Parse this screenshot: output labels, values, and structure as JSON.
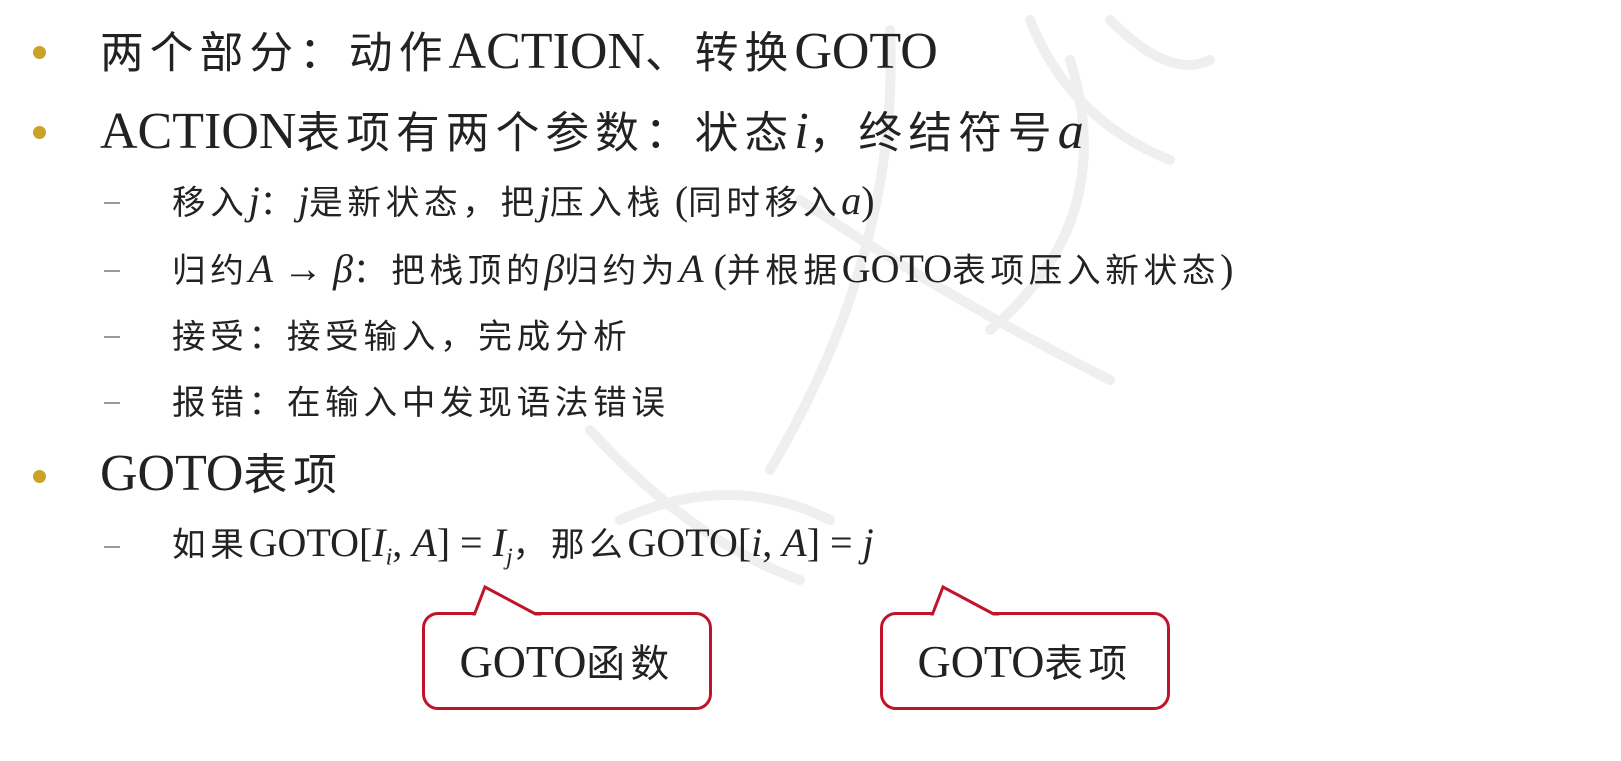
{
  "bullets": [
    {
      "text_a": "两个部分：动作",
      "text_b": "ACTION",
      "text_c": "、转换",
      "text_d": "GOTO"
    },
    {
      "text_a": "ACTION",
      "text_b": "表项有两个参数：状态",
      "var_i": "i",
      "text_c": "，终结符号",
      "var_a": "a",
      "subitems": [
        {
          "label": "移入",
          "var_j": "j",
          "sep": "：",
          "var_j2": "j",
          "mid": "是新状态，把",
          "var_j3": "j",
          "mid2": "压入栈",
          "paren_open": " (",
          "paren_text": "同时移入",
          "var_a": "a",
          "paren_close": ")"
        },
        {
          "label": "归约",
          "var_A": "A",
          "arrow": " → ",
          "var_beta": "β",
          "sep": "：",
          "mid": "把栈顶的",
          "var_beta2": "β",
          "mid2": "归约为",
          "var_A2": "A",
          "paren_open": " (",
          "paren_text": "并根据",
          "goto": "GOTO",
          "paren_text2": "表项压入新状态",
          "paren_close": ")"
        },
        {
          "label": "接受",
          "sep": "：",
          "text": "接受输入，完成分析"
        },
        {
          "label": "报错",
          "sep": "：",
          "text": "在输入中发现语法错误"
        }
      ]
    },
    {
      "text_a": "GOTO",
      "text_b": "表项",
      "subitems": [
        {
          "label": "如果",
          "goto1": "GOTO[",
          "var_I": "I",
          "sub_i": "i",
          "comma": ", ",
          "var_A": "A",
          "eq": "] = ",
          "var_I2": "I",
          "sub_j": "j",
          "sep": "，那么",
          "goto2": "GOTO[",
          "var_i": "i",
          "comma2": ", ",
          "var_A2": "A",
          "eq2": "] = ",
          "var_j": "j"
        }
      ]
    }
  ],
  "callouts": [
    {
      "latin": "GOTO",
      "cjk": "函数"
    },
    {
      "latin": "GOTO",
      "cjk": "表项"
    }
  ],
  "colors": {
    "bullet": "#c9a227",
    "callout_border": "#c0142a",
    "text": "#222222"
  }
}
